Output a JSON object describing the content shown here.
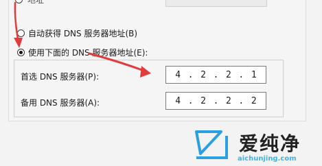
{
  "top_option_fragment": "地址",
  "options": {
    "auto_label": "自动获得 DNS 服务器地址(B)",
    "manual_label": "使用下面的 DNS 服务器地址(E):"
  },
  "dns": {
    "preferred_label": "首选 DNS 服务器(P):",
    "preferred_octets": [
      "4",
      "2",
      "2",
      "1"
    ],
    "alternate_label": "备用 DNS 服务器(A):",
    "alternate_octets": [
      "4",
      "2",
      "2",
      "2"
    ]
  },
  "watermark": {
    "title": "爱纯净",
    "url": "aichunjing.com"
  },
  "colors": {
    "arrow": "#e23b3b",
    "watermark_blue": "#2aa0e0"
  }
}
